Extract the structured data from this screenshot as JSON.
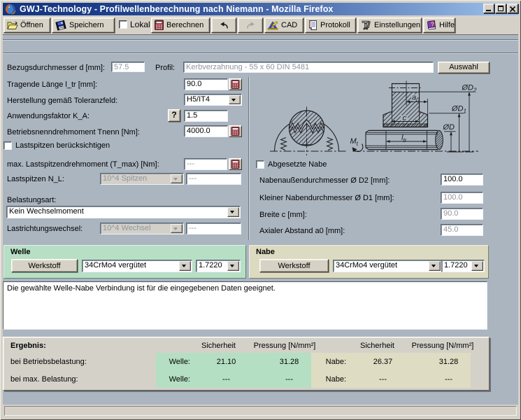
{
  "window": {
    "title": "GWJ-Technology - Profilwellenberechnung nach Niemann - Mozilla Firefox"
  },
  "toolbar": {
    "open_label": "Öffnen",
    "save_label": "Speichern",
    "local_label": "Lokal",
    "calculate_label": "Berechnen",
    "cad_label": "CAD",
    "protocol_label": "Protokoll",
    "settings_label": "Einstellungen",
    "help_label": "Hilfe",
    "help_glyph": "?"
  },
  "form": {
    "ref_diameter_label": "Bezugsdurchmesser d [mm]:",
    "ref_diameter_value": "57.5",
    "profile_label": "Profil:",
    "profile_value": "Kerbverzahnung - 55 x 60 DIN 5481",
    "profile_button": "Auswahl",
    "length_label": "Tragende Länge l_tr [mm]:",
    "length_value": "90.0",
    "tolerance_label": "Herstellung gemäß Toleranzfeld:",
    "tolerance_value": "H5/IT4",
    "app_factor_label": "Anwendungsfaktor K_A:",
    "app_factor_help": "?",
    "app_factor_value": "1.5",
    "torque_label": "Betriebsnenndrehmoment Tnenn [Nm]:",
    "torque_value": "4000.0",
    "peaks_checkbox_label": "Lastspitzen berücksichtigen",
    "max_torque_label": "max. Lastspitzendrehmoment (T_max) [Nm]:",
    "max_torque_value": "---",
    "peaks_label": "Lastspitzen N_L:",
    "peaks_select_value": "10^4 Spitzen",
    "peaks_value": "---",
    "load_type_label": "Belastungsart:",
    "load_type_value": "Kein Wechselmoment",
    "direction_label": "Lastrichtungswechsel:",
    "direction_select_value": "10^4 Wechsel",
    "direction_value": "---",
    "stepped_hub_label": "Abgesetzte Nabe",
    "d2_label": "Nabenaußendurchmesser Ø D2 [mm]:",
    "d2_value": "100.0",
    "d1_label": "Kleiner Nabendurchmesser Ø D1 [mm]:",
    "d1_value": "100.0",
    "width_label": "Breite c [mm]:",
    "width_value": "90.0",
    "a0_label": "Axialer Abstand a0 [mm]:",
    "a0_value": "45.0"
  },
  "diagram": {
    "dim_d2_main": "ØD",
    "dim_d2_sub": "2",
    "dim_d1_main": "ØD",
    "dim_d1_sub": "1",
    "dim_d_main": "ØD",
    "dim_a0_main": "a",
    "dim_a0_sub": "0",
    "dim_c": "c",
    "dim_ltr_main": "l",
    "dim_ltr_sub": "tr",
    "torque_main": "M",
    "torque_sub": "t"
  },
  "materials": {
    "shaft_title": "Welle",
    "shaft_button": "Werkstoff",
    "shaft_material": "34CrMo4 vergütet",
    "shaft_number": "1.7220",
    "hub_title": "Nabe",
    "hub_button": "Werkstoff",
    "hub_material": "34CrMo4 vergütet",
    "hub_number": "1.7220"
  },
  "message": {
    "text": "Die gewählte Welle-Nabe Verbindung ist für die eingegebenen Daten geeignet."
  },
  "results": {
    "title": "Ergebnis:",
    "safety_header": "Sicherheit",
    "pressure_header": "Pressung [N/mm²]",
    "rows": [
      {
        "label": "bei Betriebsbelastung:",
        "shaft_prefix": "Welle:",
        "shaft_safety": "21.10",
        "shaft_pressure": "31.28",
        "hub_prefix": "Nabe:",
        "hub_safety": "26.37",
        "hub_pressure": "31.28"
      },
      {
        "label": "bei max. Belastung:",
        "shaft_prefix": "Welle:",
        "shaft_safety": "---",
        "shaft_pressure": "---",
        "hub_prefix": "Nabe:",
        "hub_safety": "---",
        "hub_pressure": "---"
      }
    ]
  },
  "colors": {
    "titlebar_left": "#14347e",
    "titlebar_right": "#9fc3ec",
    "content_bg": "#abb5c0",
    "chrome_bg": "#d5d1c9",
    "shaft_panel_bg": "#b7dfc5",
    "hub_panel_bg": "#dcdbc1",
    "result_shaft_bg": "#b5dfc3",
    "result_hub_bg": "#dedcc2"
  }
}
